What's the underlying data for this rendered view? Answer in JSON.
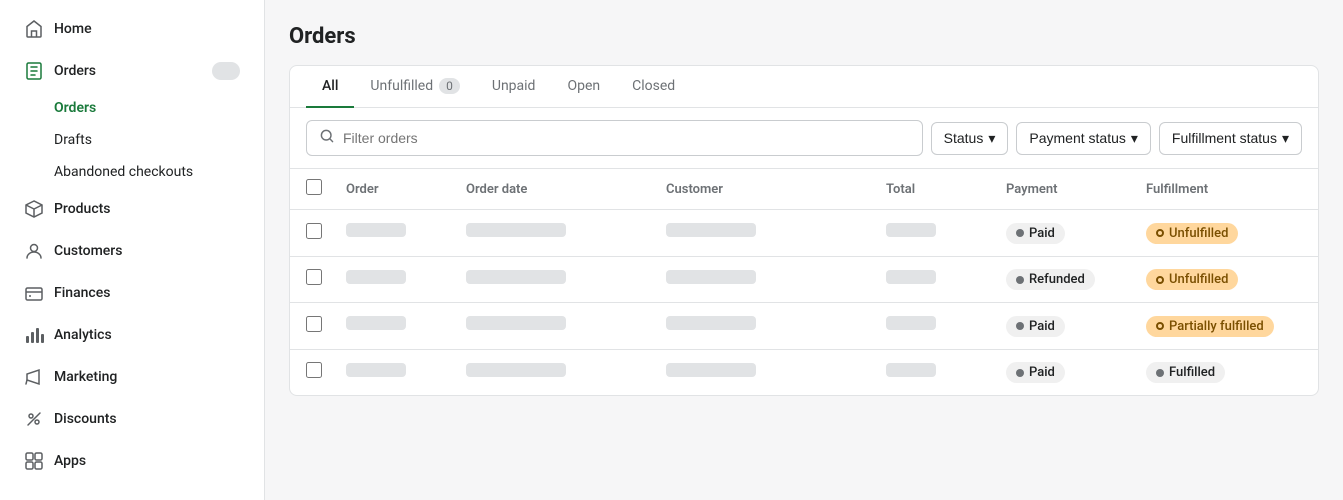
{
  "sidebar": {
    "items": [
      {
        "id": "home",
        "label": "Home",
        "icon": "home"
      },
      {
        "id": "orders",
        "label": "Orders",
        "icon": "orders",
        "badge": ""
      },
      {
        "id": "products",
        "label": "Products",
        "icon": "products"
      },
      {
        "id": "customers",
        "label": "Customers",
        "icon": "customers"
      },
      {
        "id": "finances",
        "label": "Finances",
        "icon": "finances"
      },
      {
        "id": "analytics",
        "label": "Analytics",
        "icon": "analytics"
      },
      {
        "id": "marketing",
        "label": "Marketing",
        "icon": "marketing"
      },
      {
        "id": "discounts",
        "label": "Discounts",
        "icon": "discounts"
      },
      {
        "id": "apps",
        "label": "Apps",
        "icon": "apps"
      }
    ],
    "subitems": {
      "orders": [
        {
          "id": "orders-main",
          "label": "Orders"
        },
        {
          "id": "orders-drafts",
          "label": "Drafts"
        },
        {
          "id": "orders-abandoned",
          "label": "Abandoned checkouts"
        }
      ]
    }
  },
  "page": {
    "title": "Orders",
    "tabs": [
      {
        "id": "all",
        "label": "All",
        "active": true,
        "badge": null
      },
      {
        "id": "unfulfilled",
        "label": "Unfulfilled",
        "active": false,
        "badge": "0"
      },
      {
        "id": "unpaid",
        "label": "Unpaid",
        "active": false,
        "badge": null
      },
      {
        "id": "open",
        "label": "Open",
        "active": false,
        "badge": null
      },
      {
        "id": "closed",
        "label": "Closed",
        "active": false,
        "badge": null
      }
    ],
    "filters": {
      "search_placeholder": "Filter orders",
      "status_label": "Status",
      "payment_status_label": "Payment status",
      "fulfillment_status_label": "Fulfillment status"
    },
    "table": {
      "headers": [
        "",
        "Order",
        "Order date",
        "Customer",
        "Total",
        "Payment",
        "Fulfillment"
      ],
      "rows": [
        {
          "order": "blurred",
          "date": "blurred",
          "customer": "blurred",
          "total": "blurred",
          "payment": "Paid",
          "payment_type": "paid",
          "fulfillment": "Unfulfilled",
          "fulfillment_type": "unfulfilled"
        },
        {
          "order": "blurred",
          "date": "blurred",
          "customer": "blurred",
          "total": "blurred",
          "payment": "Refunded",
          "payment_type": "refunded",
          "fulfillment": "Unfulfilled",
          "fulfillment_type": "unfulfilled"
        },
        {
          "order": "blurred",
          "date": "blurred",
          "customer": "blurred",
          "total": "blurred",
          "payment": "Paid",
          "payment_type": "paid",
          "fulfillment": "Partially fulfilled",
          "fulfillment_type": "partially"
        },
        {
          "order": "blurred",
          "date": "blurred",
          "customer": "blurred",
          "total": "blurred",
          "payment": "Paid",
          "payment_type": "paid",
          "fulfillment": "Fulfilled",
          "fulfillment_type": "fulfilled"
        }
      ]
    }
  }
}
